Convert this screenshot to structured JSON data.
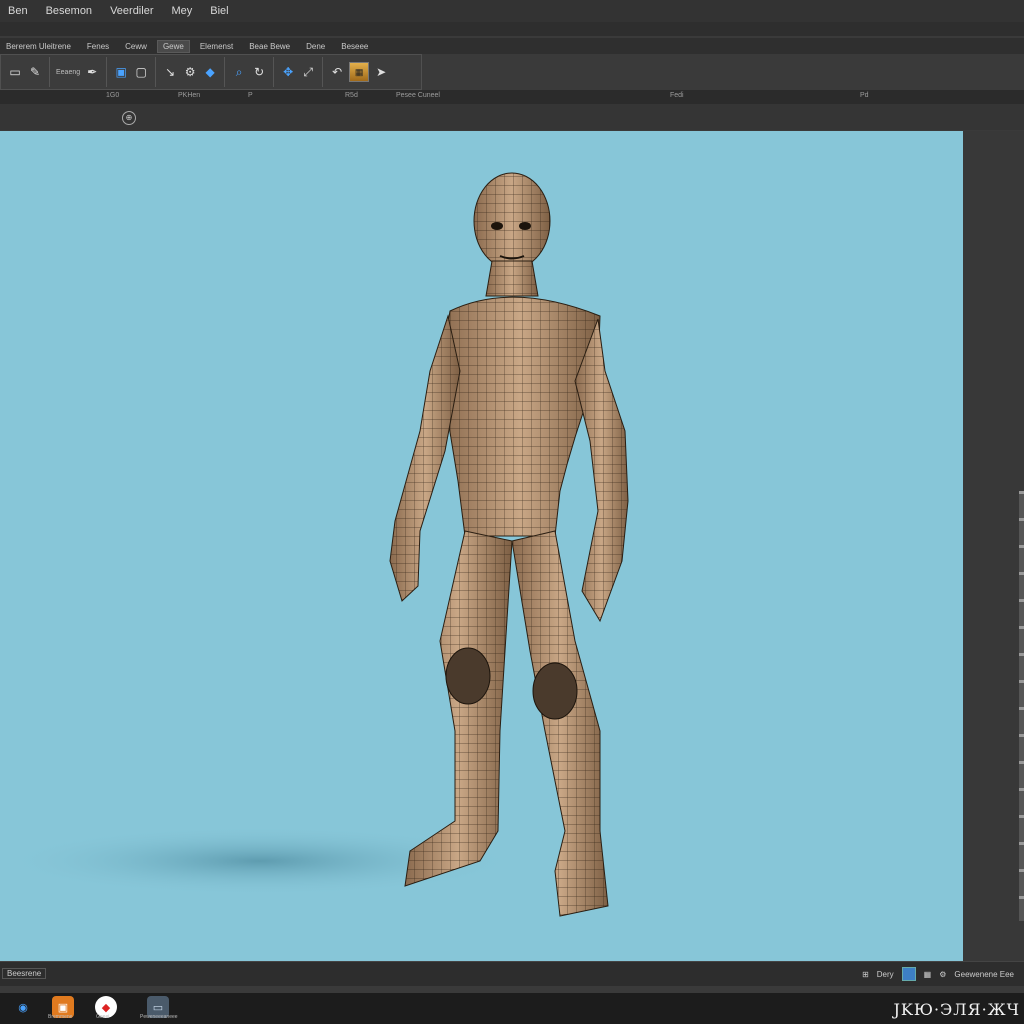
{
  "menubar": {
    "items": [
      "Ben",
      "Besemon",
      "Veerdiler",
      "Mey",
      "Biel"
    ]
  },
  "tabs": {
    "items": [
      "Bererem Uleitrene",
      "Fenes",
      "Ceww",
      "Gewe",
      "Elemenst",
      "Beae Bewe",
      "Dene",
      "Beseee"
    ]
  },
  "ribbon": {
    "labels": [
      "Eeaeng"
    ]
  },
  "ruler": {
    "marks": [
      "1G0",
      "PKHen",
      "P",
      "R5d",
      "Pesee Cuneel",
      "Fedi",
      "Pd"
    ]
  },
  "statusbar": {
    "left": "Beesrene",
    "right_label": "Dery",
    "right_label_2": "Geewenene Eee"
  },
  "taskbar": {
    "items": [
      {
        "icon": "blue-app-icon",
        "label": ""
      },
      {
        "icon": "orange-app-icon",
        "label": "Bremmene"
      },
      {
        "icon": "red-app-icon",
        "label": "Geeei"
      },
      {
        "icon": "monitor-app-icon",
        "label": "Peweneeeaneee"
      }
    ]
  },
  "wordmark": "JKЮ·ЭЛЯ·ЖЧ",
  "colors": {
    "viewport_bg": "#87c6d8",
    "ui_bg": "#3a3a3a",
    "accent": "#3d7fc4"
  }
}
